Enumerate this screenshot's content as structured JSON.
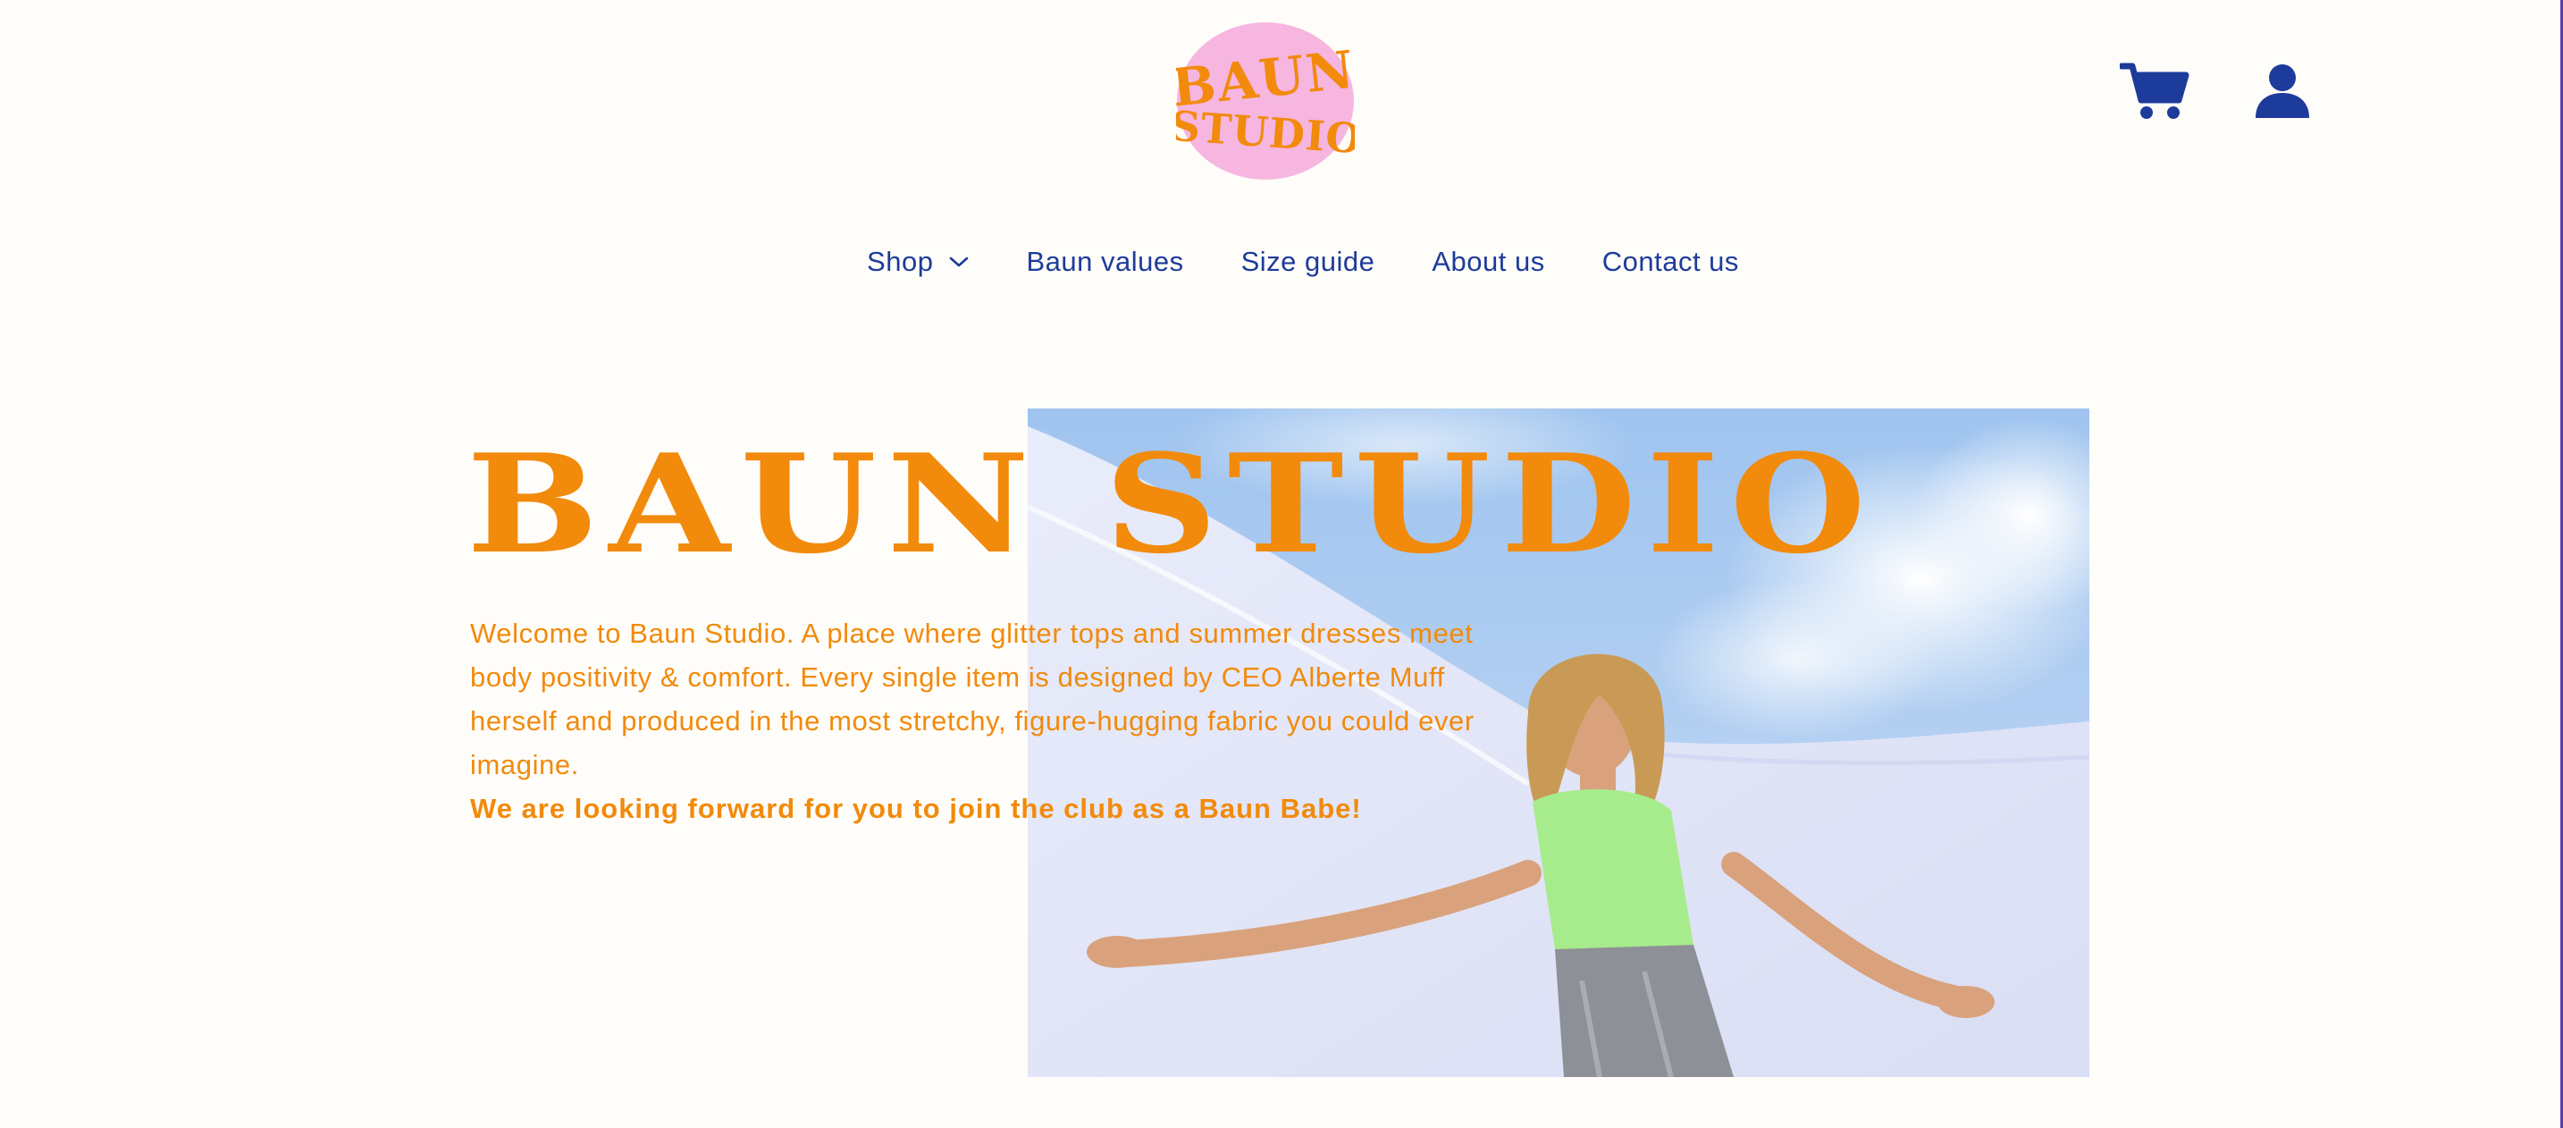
{
  "header": {
    "logo_text": "BAUN STUDIO",
    "logo_icon": "baun-studio-logo",
    "cart_icon": "cart-icon",
    "account_icon": "account-icon"
  },
  "nav": {
    "items": [
      {
        "label": "Shop",
        "has_dropdown": true
      },
      {
        "label": "Baun values"
      },
      {
        "label": "Size guide"
      },
      {
        "label": "About us"
      },
      {
        "label": "Contact us"
      }
    ]
  },
  "hero": {
    "title": "BAUN STUDIO",
    "paragraph": "Welcome to Baun Studio. A place where glitter tops and summer dresses meet body positivity & comfort. Every single item is designed by CEO Alberte Muff herself and produced in the most stretchy, figure-hugging fabric you could ever imagine.",
    "tagline": "We are looking forward for you to join the club as a Baun Babe!"
  },
  "colors": {
    "background": "#fffdf9",
    "brand_orange": "#f28a0c",
    "nav_blue": "#1d3b9b",
    "logo_pink": "#f6b6e0"
  }
}
